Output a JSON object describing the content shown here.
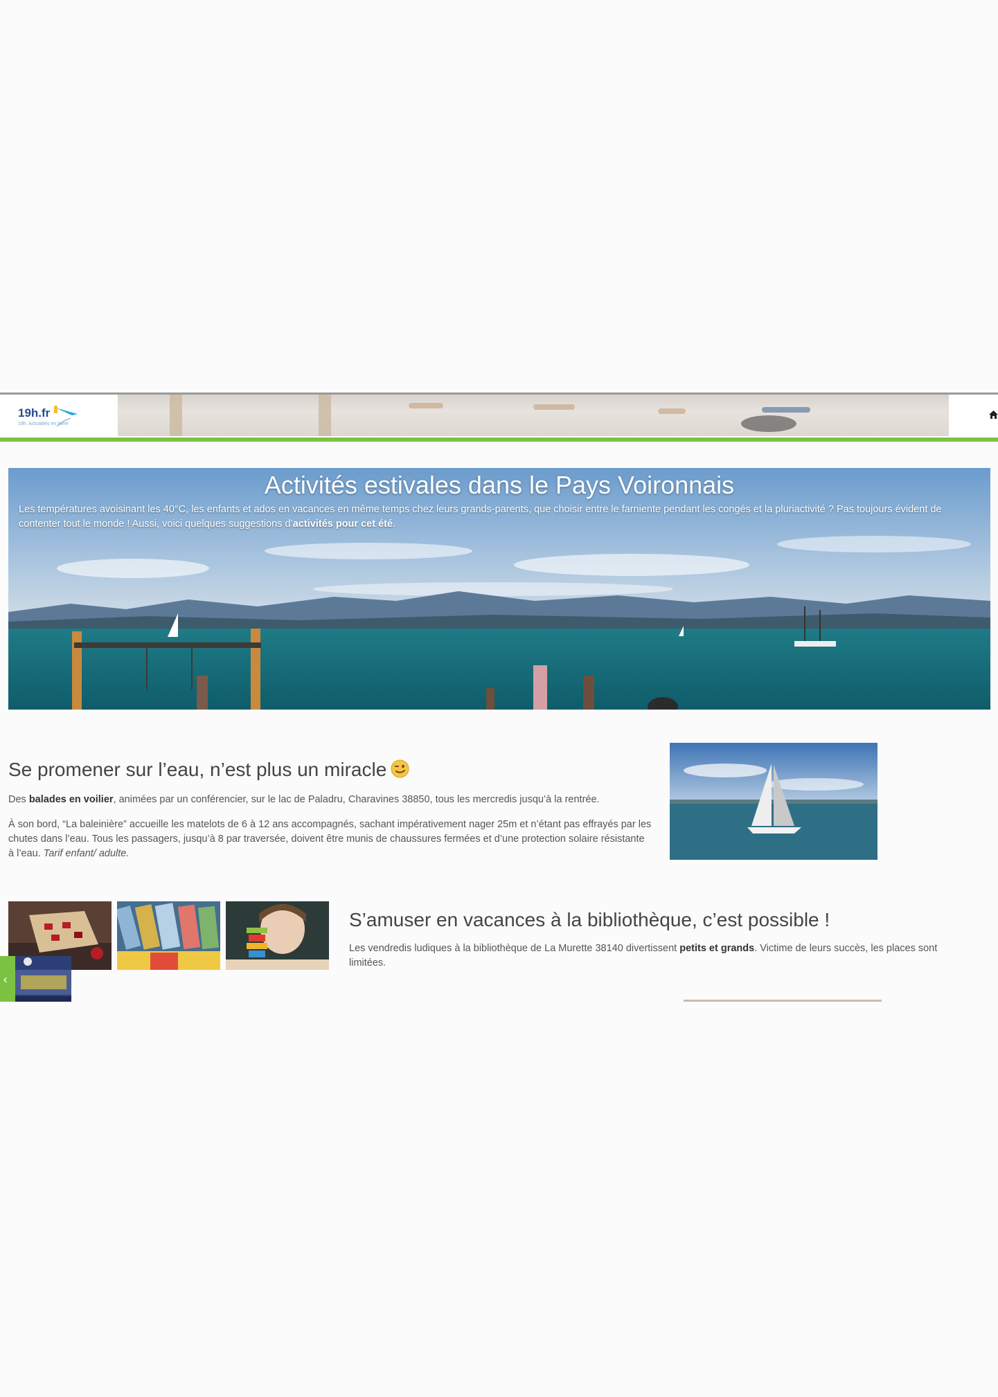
{
  "site": {
    "logo_text": "19h.fr",
    "logo_tagline": "19h. Actualités en Isère"
  },
  "hero": {
    "title": "Activités estivales dans le Pays Voironnais",
    "intro_prefix": "Les températures avoisinant les 40°C, les enfants et ados en vacances en même temps chez leurs grands-parents, que choisir entre le farniente pendant les congés et la pluriactivité ? Pas toujours évident de contenter tout le monde ! Aussi, voici quelques suggestions d’",
    "intro_bold": "activités pour cet été",
    "intro_suffix": "."
  },
  "section_water": {
    "title": "Se promener sur l’eau, n’est plus un miracle",
    "p1_prefix": "Des ",
    "p1_bold": "balades en voilier",
    "p1_suffix": ", animées par un conférencier, sur le lac de Paladru, Charavines 38850, tous les mercredis jusqu’à la rentrée.",
    "p2_text": "À son bord, “La baleinière” accueille les matelots de 6 à 12 ans accompagnés,  sachant impérativement nager 25m et n’étant pas effrayés par les chutes dans l’eau. Tous les passagers, jusqu’à 8 par traversée, doivent être munis de chaussures fermées et d’une protection solaire résistante à l’eau. ",
    "p2_italic": "Tarif enfant/ adulte."
  },
  "section_library": {
    "title": "S’amuser en vacances à la bibliothèque, c’est possible !",
    "p1_prefix": "Les vendredis ludiques à la bibliothèque de La Murette 38140 divertissent ",
    "p1_bold": "petits et grands",
    "p1_suffix": ". Victime de leurs succès, les places sont limitées."
  },
  "nav": {
    "prev_arrow": "‹"
  },
  "colors": {
    "accent_green": "#7cc242",
    "logo_blue": "#2a4a8e"
  },
  "icons": [
    "home-icon",
    "wink-emoji-icon",
    "paper-plane-icon",
    "chevron-left-icon"
  ]
}
